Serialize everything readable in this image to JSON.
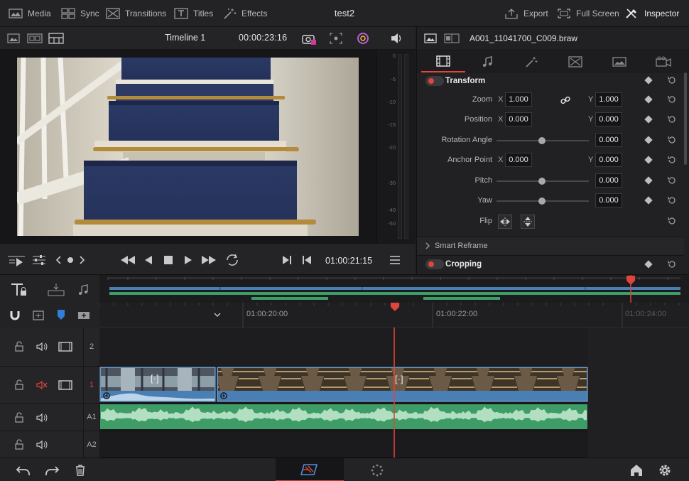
{
  "topbar": {
    "media": "Media",
    "sync": "Sync",
    "transitions": "Transitions",
    "titles": "Titles",
    "effects": "Effects",
    "project_title": "test2",
    "export": "Export",
    "fullscreen": "Full Screen",
    "inspector": "Inspector"
  },
  "viewer": {
    "timeline_name": "Timeline 1",
    "duration_timecode": "00:00:23:16",
    "meter_labels": [
      "0",
      "-5",
      "-10",
      "-15",
      "-20",
      "-30",
      "-40",
      "-50"
    ]
  },
  "transport": {
    "timecode": "01:00:21:15"
  },
  "inspector": {
    "clip_name": "A001_11041700_C009.braw",
    "transform": {
      "title": "Transform",
      "zoom_label": "Zoom",
      "zoom_x": "1.000",
      "zoom_y": "1.000",
      "position_label": "Position",
      "position_x": "0.000",
      "position_y": "0.000",
      "rotation_label": "Rotation Angle",
      "rotation_value": "0.000",
      "anchor_label": "Anchor Point",
      "anchor_x": "0.000",
      "anchor_y": "0.000",
      "pitch_label": "Pitch",
      "pitch_value": "0.000",
      "yaw_label": "Yaw",
      "yaw_value": "0.000",
      "flip_label": "Flip",
      "axis_x": "X",
      "axis_y": "Y"
    },
    "smart_reframe": "Smart Reframe",
    "cropping": "Cropping"
  },
  "timeline": {
    "ruler": [
      "01:00:20:00",
      "01:00:22:00",
      "01:00:24:00"
    ],
    "tracks": [
      {
        "name": "2",
        "type": "video"
      },
      {
        "name": "1",
        "type": "video",
        "muted": true
      },
      {
        "name": "A1",
        "type": "audio"
      },
      {
        "name": "A2",
        "type": "audio"
      }
    ]
  },
  "colors": {
    "accent": "#e0443a",
    "clip_video": "#4a7fb5",
    "clip_audio": "#3e9c67"
  }
}
